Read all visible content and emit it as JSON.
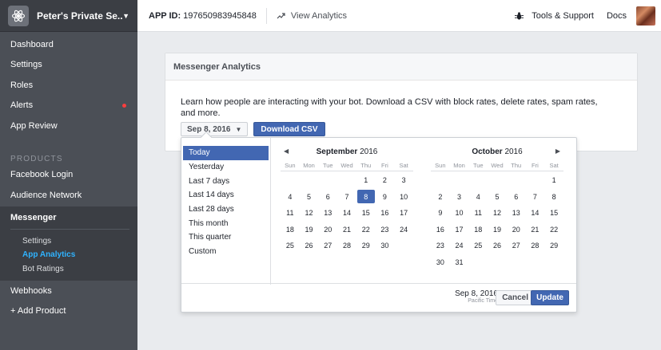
{
  "app": {
    "name": "Peter's Private Se...",
    "id_label": "APP ID:",
    "id_value": "197650983945848"
  },
  "topbar": {
    "view_analytics": "View Analytics",
    "tools_support": "Tools & Support",
    "docs": "Docs"
  },
  "sidebar": {
    "items": [
      {
        "label": "Dashboard"
      },
      {
        "label": "Settings"
      },
      {
        "label": "Roles"
      },
      {
        "label": "Alerts"
      },
      {
        "label": "App Review"
      }
    ],
    "products_header": "PRODUCTS",
    "product_items": [
      {
        "label": "Facebook Login"
      },
      {
        "label": "Audience Network"
      }
    ],
    "messenger": {
      "label": "Messenger",
      "sub_items": [
        {
          "label": "Settings"
        },
        {
          "label": "App Analytics"
        },
        {
          "label": "Bot Ratings"
        }
      ]
    },
    "bottom_items": [
      {
        "label": "Webhooks"
      },
      {
        "label": "+ Add Product"
      }
    ]
  },
  "panel": {
    "title": "Messenger Analytics",
    "description": "Learn how people are interacting with your bot. Download a CSV with block rates, delete rates, spam rates, and more.",
    "date_dropdown": "Sep 8, 2016",
    "download_csv": "Download CSV"
  },
  "picker": {
    "presets": [
      "Today",
      "Yesterday",
      "Last 7 days",
      "Last 14 days",
      "Last 28 days",
      "This month",
      "This quarter",
      "Custom"
    ],
    "selected_preset": "Today",
    "weekdays": [
      "Sun",
      "Mon",
      "Tue",
      "Wed",
      "Thu",
      "Fri",
      "Sat"
    ],
    "months": [
      {
        "name": "September",
        "year": "2016",
        "days": [
          "",
          "",
          "",
          "",
          "1",
          "2",
          "3",
          "4",
          "5",
          "6",
          "7",
          "8",
          "9",
          "10",
          "11",
          "12",
          "13",
          "14",
          "15",
          "16",
          "17",
          "18",
          "19",
          "20",
          "21",
          "22",
          "23",
          "24",
          "25",
          "26",
          "27",
          "28",
          "29",
          "30",
          ""
        ],
        "selected": "8"
      },
      {
        "name": "October",
        "year": "2016",
        "days": [
          "",
          "",
          "",
          "",
          "",
          "",
          "1",
          "2",
          "3",
          "4",
          "5",
          "6",
          "7",
          "8",
          "9",
          "10",
          "11",
          "12",
          "13",
          "14",
          "15",
          "16",
          "17",
          "18",
          "19",
          "20",
          "21",
          "22",
          "23",
          "24",
          "25",
          "26",
          "27",
          "28",
          "29",
          "30",
          "31",
          "",
          "",
          "",
          "",
          ""
        ],
        "selected": ""
      }
    ],
    "footer_date": "Sep 8, 2016",
    "footer_timezone": "Pacific Time",
    "cancel": "Cancel",
    "update": "Update"
  }
}
